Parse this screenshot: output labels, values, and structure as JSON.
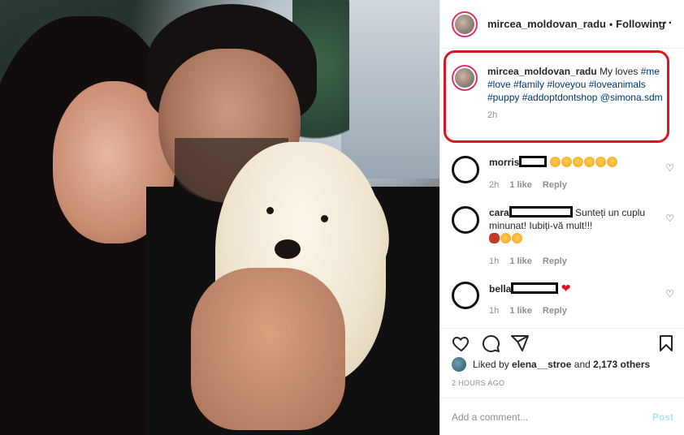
{
  "post": {
    "username": "mircea_moldovan_radu",
    "follow_status": "Following",
    "caption_text": "My loves",
    "caption_tags": "#me #love #family #loveyou #loveanimals #puppy #addoptdontshop @simona.sdm",
    "caption_time": "2h"
  },
  "comments": [
    {
      "user": "morris",
      "text": "",
      "time": "2h",
      "likes": "1 like",
      "reply": "Reply"
    },
    {
      "user": "cara",
      "text": "Sunteți un cuplu minunat! Iubiți-vă mult!!!",
      "time": "1h",
      "likes": "1 like",
      "reply": "Reply"
    },
    {
      "user": "bella",
      "text": "",
      "time": "1h",
      "likes": "1 like",
      "reply": "Reply"
    }
  ],
  "likes": {
    "prefix": "Liked by",
    "user": "elena__stroe",
    "conj": "and",
    "count": "2,173 others"
  },
  "posted_ago": "2 HOURS AGO",
  "add_comment": {
    "placeholder": "Add a comment...",
    "post_label": "Post"
  },
  "colors": {
    "highlight": "#d7191f",
    "link": "#00376b",
    "muted": "#8e8e8e",
    "heart": "#e0112b"
  },
  "icons": [
    "more-icon",
    "heart-icon",
    "comment-icon",
    "share-icon",
    "bookmark-icon"
  ]
}
